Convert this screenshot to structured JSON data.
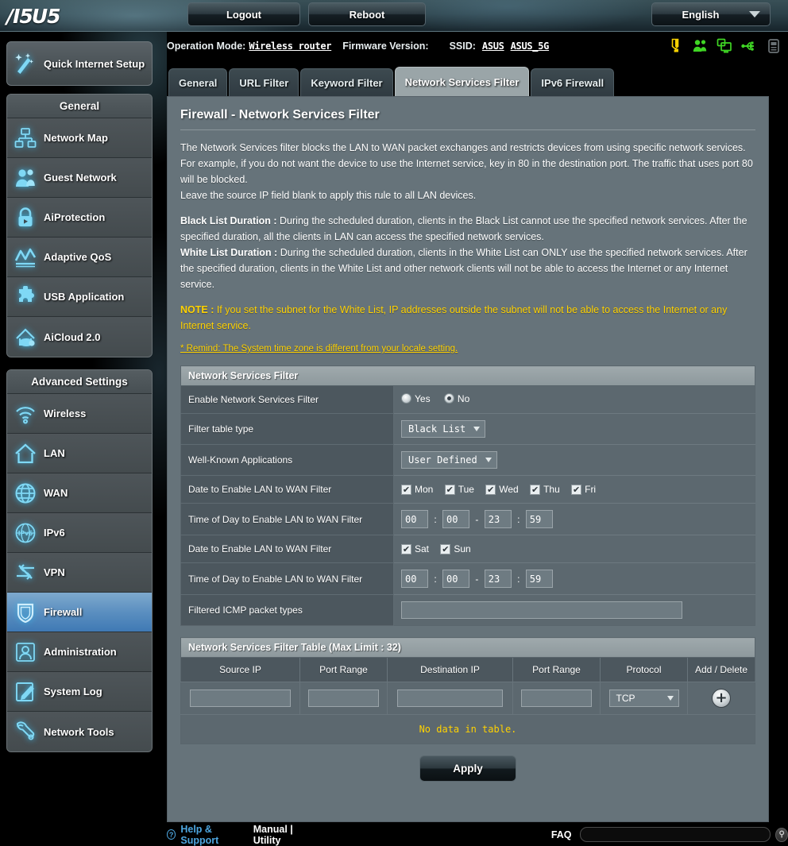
{
  "brand": {
    "logo_text": "/ISUS"
  },
  "topbar": {
    "logout_label": "Logout",
    "reboot_label": "Reboot",
    "language": "English"
  },
  "infobar": {
    "operation_mode_label": "Operation Mode:",
    "operation_mode_value": "Wireless router",
    "firmware_label": "Firmware Version:",
    "firmware_value": "",
    "ssid_label": "SSID:",
    "ssid_1": "ASUS",
    "ssid_2": "ASUS_5G",
    "icons": [
      "alert-icon",
      "guest-users-icon",
      "client-devices-icon",
      "usb-icon",
      "printer-icon"
    ],
    "icon_colors": {
      "alert": "#f5d000",
      "active": "#3fd624",
      "inactive": "#6b7276"
    }
  },
  "sidebar": {
    "quick_setup_label": "Quick Internet Setup",
    "quick_setup_icon": "magic-wand-icon",
    "groups": [
      {
        "title": "General",
        "items": [
          {
            "label": "Network Map",
            "icon": "network-map-icon",
            "active": false
          },
          {
            "label": "Guest Network",
            "icon": "guest-network-icon",
            "active": false
          },
          {
            "label": "AiProtection",
            "icon": "lock-shield-icon",
            "active": false
          },
          {
            "label": "Adaptive QoS",
            "icon": "qos-chart-icon",
            "active": false
          },
          {
            "label": "USB Application",
            "icon": "puzzle-piece-icon",
            "active": false
          },
          {
            "label": "AiCloud 2.0",
            "icon": "cloud-home-icon",
            "active": false
          }
        ]
      },
      {
        "title": "Advanced Settings",
        "items": [
          {
            "label": "Wireless",
            "icon": "wifi-icon",
            "active": false
          },
          {
            "label": "LAN",
            "icon": "home-icon",
            "active": false
          },
          {
            "label": "WAN",
            "icon": "globe-icon",
            "active": false
          },
          {
            "label": "IPv6",
            "icon": "ipv6-globe-icon",
            "active": false
          },
          {
            "label": "VPN",
            "icon": "vpn-arrows-icon",
            "active": false
          },
          {
            "label": "Firewall",
            "icon": "shield-icon",
            "active": true
          },
          {
            "label": "Administration",
            "icon": "admin-user-icon",
            "active": false
          },
          {
            "label": "System Log",
            "icon": "log-pencil-icon",
            "active": false
          },
          {
            "label": "Network Tools",
            "icon": "wrench-icon",
            "active": false
          }
        ]
      }
    ]
  },
  "tabs": [
    {
      "label": "General",
      "active": false
    },
    {
      "label": "URL Filter",
      "active": false
    },
    {
      "label": "Keyword Filter",
      "active": false
    },
    {
      "label": "Network Services Filter",
      "active": true
    },
    {
      "label": "IPv6 Firewall",
      "active": false
    }
  ],
  "page": {
    "title": "Firewall - Network Services Filter",
    "paragraphs": [
      "The Network Services filter blocks the LAN to WAN packet exchanges and restricts devices from using specific network services.",
      "For example, if you do not want the device to use the Internet service, key in 80 in the destination port. The traffic that uses port 80 will be blocked.",
      "Leave the source IP field blank to apply this rule to all LAN devices."
    ],
    "black_list_term": "Black List Duration :",
    "black_list_text": " During the scheduled duration, clients in the Black List cannot use the specified network services. After the specified duration, all the clients in LAN can access the specified network services.",
    "white_list_term": "White List Duration :",
    "white_list_text": " During the scheduled duration, clients in the White List can ONLY use the specified network services. After the specified duration, clients in the White List and other network clients will not be able to access the Internet or any Internet service.",
    "note_term": "NOTE :",
    "note_text": " If you set the subnet for the White List, IP addresses outside the subnet will not be able to access the Internet or any Internet service.",
    "remind": "* Remind: The System time zone is different from your locale setting."
  },
  "form": {
    "section_title": "Network Services Filter",
    "enable": {
      "label": "Enable Network Services Filter",
      "yes_label": "Yes",
      "no_label": "No",
      "selected": "No"
    },
    "filter_table_type": {
      "label": "Filter table type",
      "value": "Black List"
    },
    "well_known_apps": {
      "label": "Well-Known Applications",
      "value": "User Defined"
    },
    "date_weekday": {
      "label": "Date to Enable LAN to WAN Filter",
      "days": [
        {
          "name": "Mon",
          "checked": true
        },
        {
          "name": "Tue",
          "checked": true
        },
        {
          "name": "Wed",
          "checked": true
        },
        {
          "name": "Thu",
          "checked": true
        },
        {
          "name": "Fri",
          "checked": true
        }
      ]
    },
    "time_weekday": {
      "label": "Time of Day to Enable LAN to WAN Filter",
      "start_hour": "00",
      "start_min": "00",
      "end_hour": "23",
      "end_min": "59",
      "separator": ":",
      "dash": "-"
    },
    "date_weekend": {
      "label": "Date to Enable LAN to WAN Filter",
      "days": [
        {
          "name": "Sat",
          "checked": true
        },
        {
          "name": "Sun",
          "checked": true
        }
      ]
    },
    "time_weekend": {
      "label": "Time of Day to Enable LAN to WAN Filter",
      "start_hour": "00",
      "start_min": "00",
      "end_hour": "23",
      "end_min": "59",
      "separator": ":",
      "dash": "-"
    },
    "icmp": {
      "label": "Filtered ICMP packet types",
      "value": ""
    }
  },
  "filter_table": {
    "title": "Network Services Filter Table (Max Limit : 32)",
    "columns": [
      "Source IP",
      "Port Range",
      "Destination IP",
      "Port Range",
      "Protocol",
      "Add / Delete"
    ],
    "new_row": {
      "source_ip": "",
      "source_port_range": "",
      "destination_ip": "",
      "destination_port_range": "",
      "protocol": "TCP",
      "add_icon": "plus-circle-icon"
    },
    "empty_message": "No data in table."
  },
  "apply_label": "Apply",
  "footer": {
    "help_label": "Help & Support",
    "manual_label": "Manual | Utility",
    "faq_label": "FAQ",
    "faq_placeholder": "",
    "search_icon": "search-icon"
  }
}
